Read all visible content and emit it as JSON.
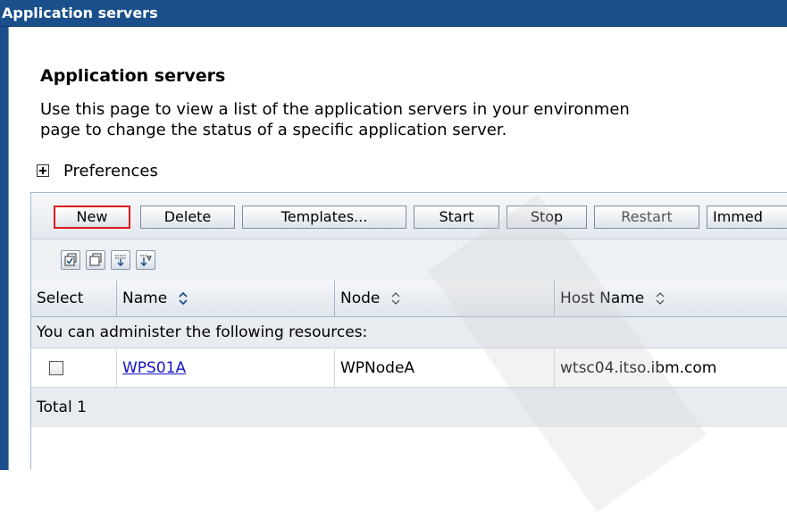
{
  "window": {
    "title": "Application servers"
  },
  "page": {
    "heading": "Application servers",
    "description_line1": "Use this page to view a list of the application servers in your environmen",
    "description_line2": "page to change the status of a specific application server."
  },
  "preferences": {
    "label": "Preferences"
  },
  "toolbar": {
    "buttons": [
      {
        "label": "New",
        "highlighted": true
      },
      {
        "label": "Delete"
      },
      {
        "label": "Templates..."
      },
      {
        "label": "Start"
      },
      {
        "label": "Stop"
      },
      {
        "label": "Restart",
        "disabled": true
      },
      {
        "label": "Immed"
      }
    ]
  },
  "icon_toolbar": {
    "icons": [
      "select-all-icon",
      "deselect-all-icon",
      "show-filter-icon",
      "clear-filter-icon"
    ]
  },
  "table": {
    "columns": [
      {
        "label": "Select"
      },
      {
        "label": "Name"
      },
      {
        "label": "Node"
      },
      {
        "label": "Host Name"
      }
    ],
    "info_text": "You can administer the following resources:",
    "rows": [
      {
        "name": "WPS01A",
        "node": "WPNodeA",
        "host": "wtsc04.itso.ibm.com"
      }
    ],
    "total_text": "Total 1"
  },
  "colors": {
    "title_bar": "#1a4f8c",
    "link": "#1515c8",
    "highlight": "#e01b1b"
  }
}
